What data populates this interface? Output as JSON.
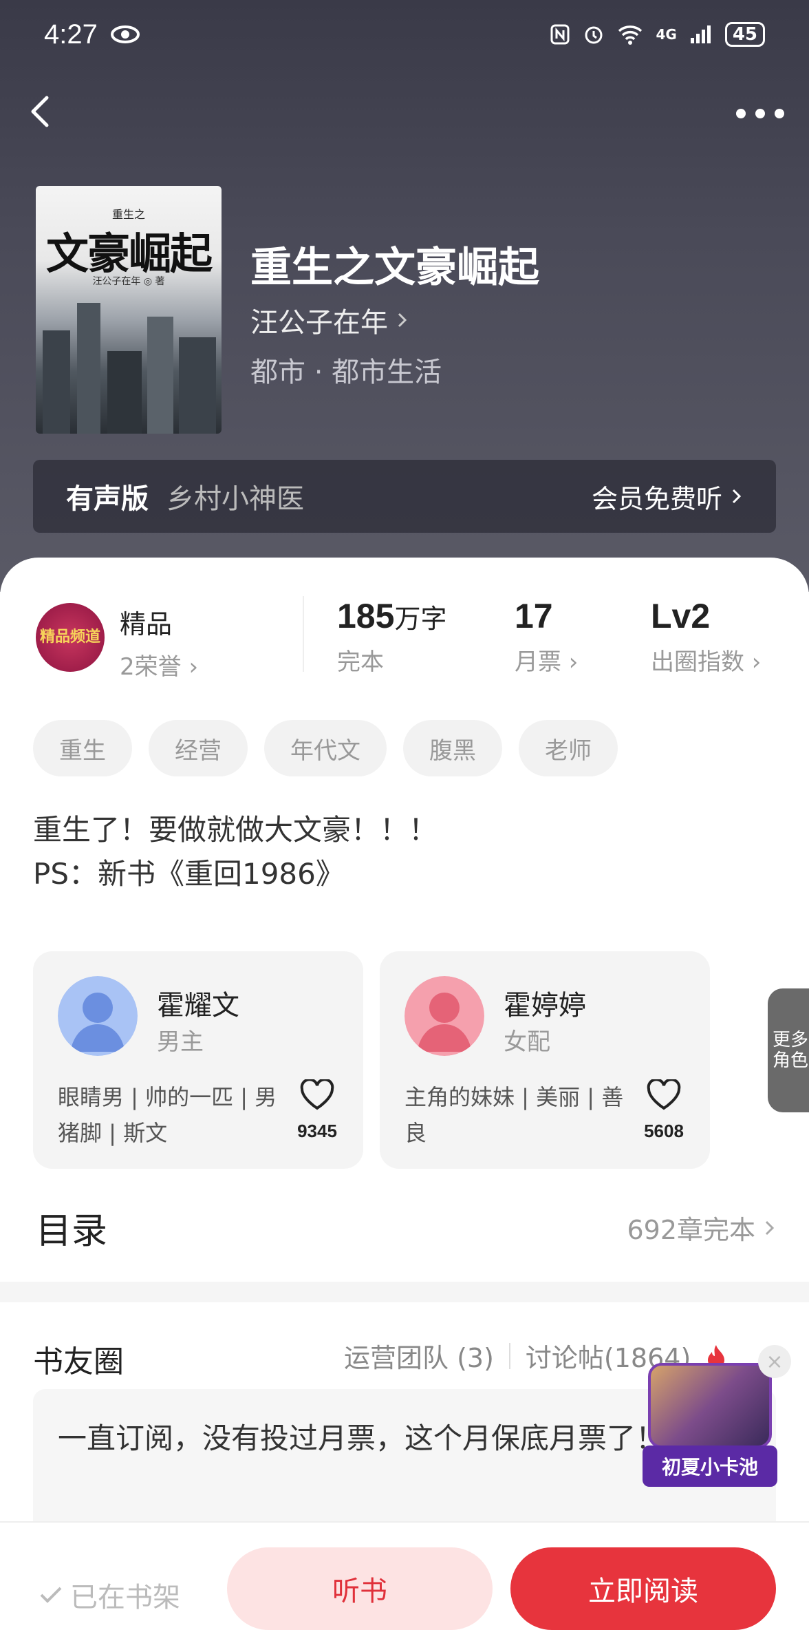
{
  "status_bar": {
    "time": "4:27",
    "battery": "45",
    "signal": "4G"
  },
  "book": {
    "cover_top": "重生之",
    "cover_title": "文豪崛起",
    "cover_author": "汪公子在年 ◎ 著",
    "title": "重生之文豪崛起",
    "author": "汪公子在年",
    "genre": "都市 · 都市生活"
  },
  "audio": {
    "label": "有声版",
    "name": "乡村小神医",
    "cta": "会员免费听"
  },
  "stats": {
    "badge_text": "精品频道",
    "honor_title": "精品",
    "honor_sub": "2荣誉",
    "words_value": "185",
    "words_unit": "万字",
    "words_label": "完本",
    "tickets_value": "17",
    "tickets_label": "月票",
    "index_value": "Lv2",
    "index_label": "出圈指数"
  },
  "tags": [
    "重生",
    "经营",
    "年代文",
    "腹黑",
    "老师"
  ],
  "description": {
    "line1": "重生了！要做就做大文豪！！！",
    "line2": "PS：新书《重回1986》"
  },
  "characters": [
    {
      "name": "霍耀文",
      "role": "男主",
      "desc": "眼睛男 | 帅的一匹 | 男猪脚 | 斯文",
      "likes": "9345",
      "avatar_color": "#a9c3f5"
    },
    {
      "name": "霍婷婷",
      "role": "女配",
      "desc": "主角的妹妹 | 美丽 | 善良",
      "likes": "5608",
      "avatar_color": "#f5a0ad"
    }
  ],
  "more_roles": "更多角色",
  "toc": {
    "title": "目录",
    "chapters": "692章完本"
  },
  "circle": {
    "title": "书友圈",
    "team": "运营团队 (3)",
    "posts": "讨论帖(1864)",
    "post_text": "一直订阅，没有投过月票，这个月保底月票了！"
  },
  "promo": {
    "label": "初夏小卡池"
  },
  "bottom": {
    "shelf": "已在书架",
    "listen": "听书",
    "read": "立即阅读"
  },
  "colors": {
    "accent": "#e7343d",
    "listen_bg": "#fde3e3",
    "hero_bg": "#44444f"
  }
}
